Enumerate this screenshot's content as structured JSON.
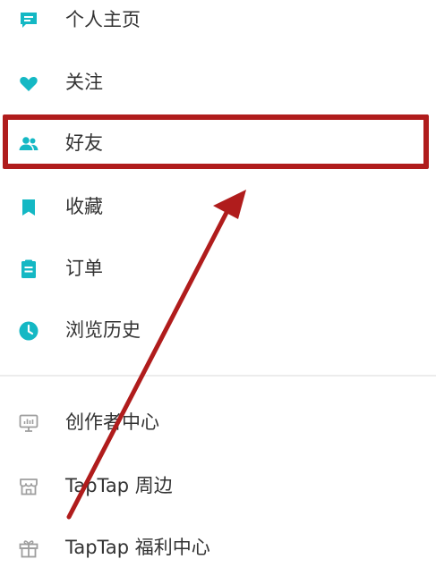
{
  "menu": {
    "items": [
      {
        "label": "个人主页",
        "icon": "profile-page-icon"
      },
      {
        "label": "关注",
        "icon": "heart-icon"
      },
      {
        "label": "好友",
        "icon": "friends-icon"
      },
      {
        "label": "收藏",
        "icon": "bookmark-icon"
      },
      {
        "label": "订单",
        "icon": "order-icon"
      },
      {
        "label": "浏览历史",
        "icon": "clock-icon"
      }
    ],
    "secondary_items": [
      {
        "label": "创作者中心",
        "icon": "creator-monitor-icon"
      },
      {
        "label": "TapTap 周边",
        "icon": "store-icon"
      },
      {
        "label": "TapTap 福利中心",
        "icon": "gift-icon"
      }
    ]
  },
  "colors": {
    "accent": "#14b8c4",
    "secondary_icon": "#9e9e9e",
    "text": "#333333",
    "annotation": "#b01c1c"
  }
}
